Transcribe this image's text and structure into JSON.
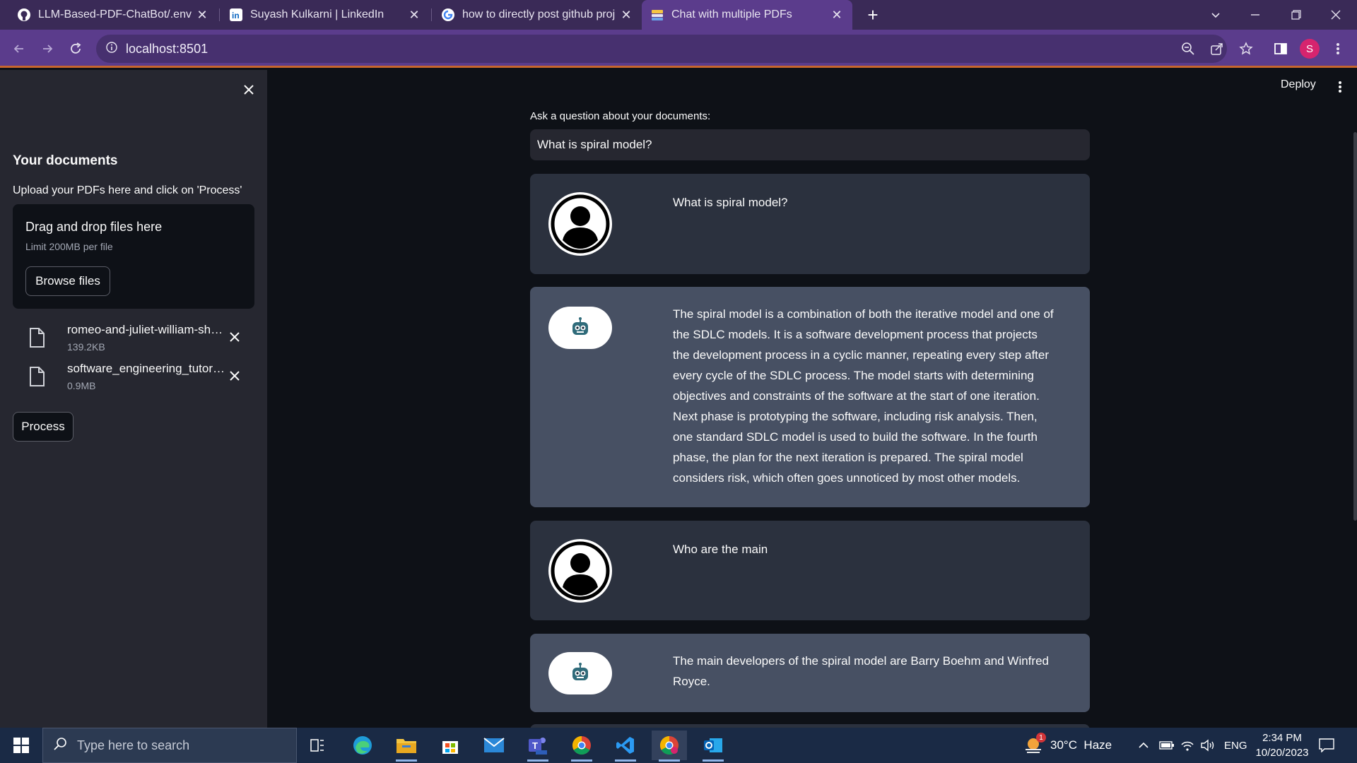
{
  "browser": {
    "tabs": [
      {
        "title": "LLM-Based-PDF-ChatBot/.env at",
        "icon": "github-icon",
        "active": false
      },
      {
        "title": "Suyash Kulkarni | LinkedIn",
        "icon": "linkedin-icon",
        "active": false
      },
      {
        "title": "how to directly post github proj",
        "icon": "google-icon",
        "active": false
      },
      {
        "title": "Chat with multiple PDFs",
        "icon": "streamlit-icon",
        "active": true
      }
    ],
    "url": "localhost:8501",
    "profile_initial": "S"
  },
  "sidebar": {
    "title": "Your documents",
    "description": "Upload your PDFs here and click on 'Process'",
    "dropzone": {
      "title": "Drag and drop files here",
      "limit": "Limit 200MB per file",
      "browse_label": "Browse files"
    },
    "files": [
      {
        "name": "romeo-and-juliet-william-shakespeare.pdf",
        "size": "139.2KB"
      },
      {
        "name": "software_engineering_tutorial.pdf",
        "size": "0.9MB"
      }
    ],
    "process_label": "Process"
  },
  "header": {
    "deploy_label": "Deploy"
  },
  "main": {
    "question_label": "Ask a question about your documents:",
    "question_value": "What is spiral model?",
    "messages": [
      {
        "role": "user",
        "text": "What is spiral model?"
      },
      {
        "role": "bot",
        "text": "The spiral model is a combination of both the iterative model and one of the SDLC models. It is a software development process that projects the development process in a cyclic manner, repeating every step after every cycle of the SDLC process. The model starts with determining objectives and constraints of the software at the start of one iteration. Next phase is prototyping the software, including risk analysis. Then, one standard SDLC model is used to build the software. In the fourth phase, the plan for the next iteration is prepared. The spiral model considers risk, which often goes unnoticed by most other models."
      },
      {
        "role": "user",
        "text": "Who are the main"
      },
      {
        "role": "bot",
        "text": "The main developers of the spiral model are Barry Boehm and Winfred Royce."
      }
    ]
  },
  "taskbar": {
    "search_placeholder": "Type here to search",
    "weather": "30°C  Haze",
    "weather_badge": "1",
    "language": "ENG",
    "time": "2:34 PM",
    "date": "10/20/2023"
  },
  "colors": {
    "tab_bar": "#3a2a57",
    "address_bar": "#5b3c8c",
    "sidebar": "#262730",
    "main_bg": "#0e1117",
    "user_msg": "#2b313e",
    "bot_msg": "#475063",
    "taskbar": "#1a2a45"
  }
}
